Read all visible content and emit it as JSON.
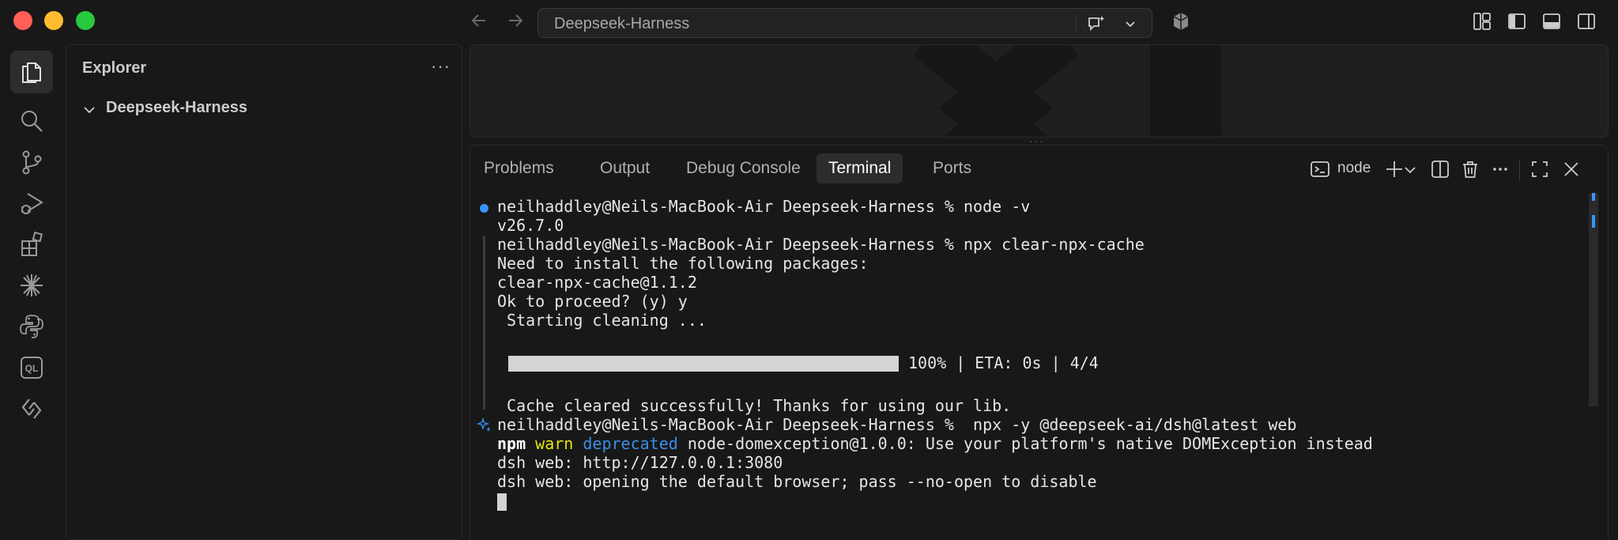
{
  "titlebar": {
    "search_text": "Deepseek-Harness",
    "icons": [
      "back-arrow-icon",
      "forward-arrow-icon",
      "chat-sparkle-icon",
      "chevron-down-icon",
      "copilot-icon",
      "customize-layout-icon",
      "toggle-primary-sidebar-icon",
      "toggle-panel-icon",
      "toggle-secondary-sidebar-icon"
    ]
  },
  "activity_bar": {
    "items": [
      "explorer-icon",
      "search-icon",
      "source-control-icon",
      "run-debug-icon",
      "extensions-icon",
      "sparkle-icon",
      "python-icon",
      "ql-icon",
      "connection-icon"
    ],
    "ql_label": "QL"
  },
  "sidebar": {
    "title": "Explorer",
    "more": "···",
    "folder": "Deepseek-Harness"
  },
  "panel": {
    "tabs": [
      {
        "label": "Problems"
      },
      {
        "label": "Output"
      },
      {
        "label": "Debug Console"
      },
      {
        "label": "Terminal",
        "active": true
      },
      {
        "label": "Ports"
      }
    ],
    "terminal_name": "node"
  },
  "terminal": {
    "l1": "neilhaddley@Neils-MacBook-Air Deepseek-Harness % node -v",
    "l2": "v26.7.0",
    "l3": "neilhaddley@Neils-MacBook-Air Deepseek-Harness % npx clear-npx-cache",
    "l4": "Need to install the following packages:",
    "l5": "clear-npx-cache@1.1.2",
    "l6": "Ok to proceed? (y) y",
    "l7": " Starting cleaning ...",
    "progress_text": "100% | ETA: 0s | 4/4",
    "progress_fraction": 1.0,
    "l9": " Cache cleared successfully! Thanks for using our lib.",
    "l10": "neilhaddley@Neils-MacBook-Air Deepseek-Harness %  npx -y @deepseek-ai/dsh@latest web",
    "l11_npm": "npm",
    "l11_warn": "warn",
    "l11_dep": "deprecated",
    "l11_rest": "node-domexception@1.0.0: Use your platform's native DOMException instead",
    "l12": "dsh web: http://127.0.0.1:3080",
    "l13": "dsh web: opening the default browser; pass --no-open to disable"
  },
  "colors": {
    "background": "#181818",
    "accent": "#3794ff",
    "warn": "#e5e510",
    "deprecated": "#3b8eea"
  }
}
